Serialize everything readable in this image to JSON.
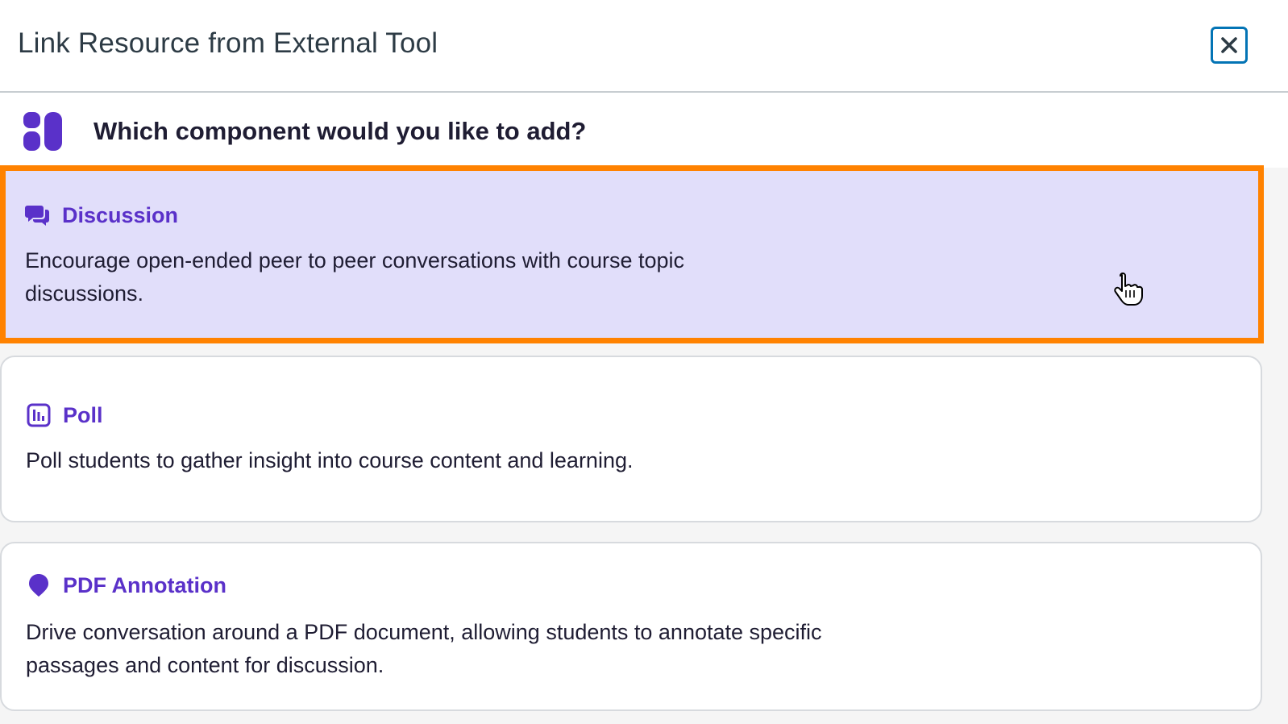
{
  "modal": {
    "title": "Link Resource from External Tool",
    "close_icon": "close-icon"
  },
  "prompt": {
    "logo_icon": "component-grid-icon",
    "text": "Which component would you like to add?"
  },
  "components": [
    {
      "icon": "discussion-bubbles-icon",
      "title": "Discussion",
      "description": "Encourage open-ended peer to peer conversations with course topic discussions.",
      "selected": true
    },
    {
      "icon": "poll-chart-icon",
      "title": "Poll",
      "description": "Poll students to gather insight into course content and learning.",
      "selected": false
    },
    {
      "icon": "pdf-annotation-pin-icon",
      "title": "PDF Annotation",
      "description": "Drive conversation around a PDF document, allowing students to annotate specific passages and content for discussion.",
      "selected": false
    }
  ],
  "colors": {
    "accent": "#5a31c9",
    "selected_bg": "#e1defa",
    "focus_ring": "#ff8200",
    "close_border": "#0374b5",
    "text": "#1f1d33"
  },
  "cursor": "hand-pointer-cursor"
}
